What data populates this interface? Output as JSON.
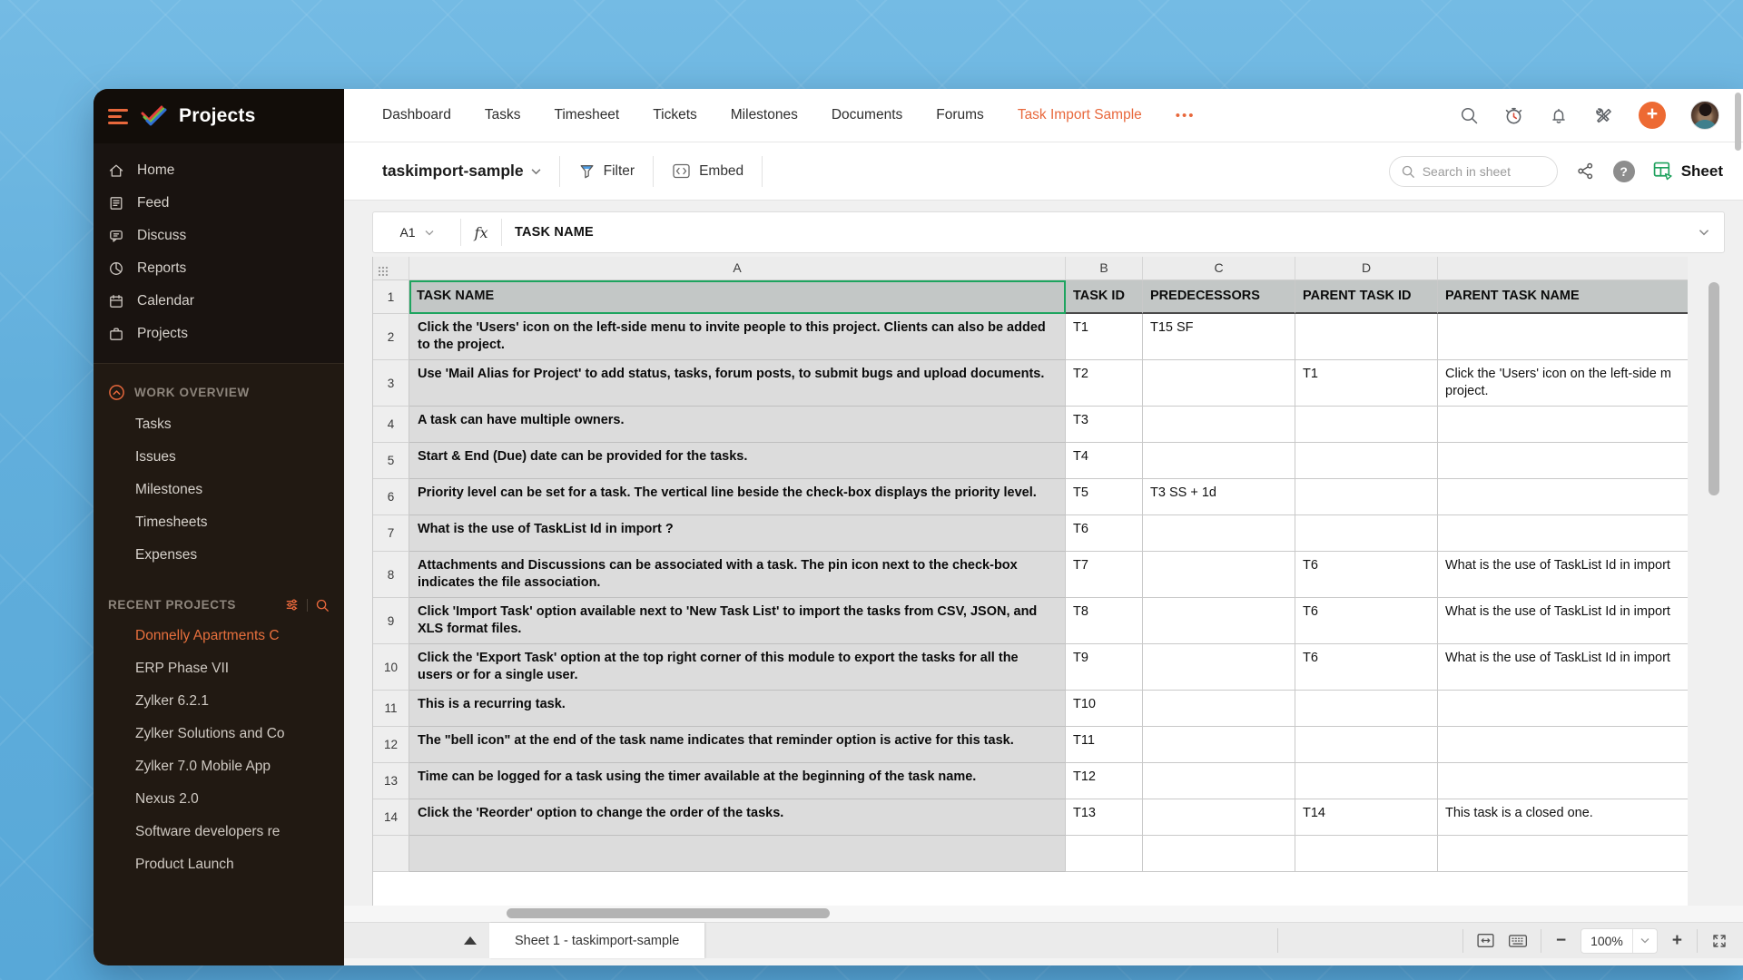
{
  "sidebar": {
    "brand": "Projects",
    "menu": [
      {
        "icon": "home-icon",
        "label": "Home"
      },
      {
        "icon": "feed-icon",
        "label": "Feed"
      },
      {
        "icon": "discuss-icon",
        "label": "Discuss"
      },
      {
        "icon": "reports-icon",
        "label": "Reports"
      },
      {
        "icon": "calendar-icon",
        "label": "Calendar"
      },
      {
        "icon": "projects-icon",
        "label": "Projects"
      }
    ],
    "work_overview": {
      "label": "WORK OVERVIEW",
      "items": [
        "Tasks",
        "Issues",
        "Milestones",
        "Timesheets",
        "Expenses"
      ]
    },
    "recent_projects": {
      "label": "RECENT PROJECTS",
      "items": [
        {
          "label": "Donnelly Apartments C",
          "active": true
        },
        {
          "label": "ERP Phase VII",
          "active": false
        },
        {
          "label": "Zylker 6.2.1",
          "active": false
        },
        {
          "label": "Zylker Solutions and Co",
          "active": false
        },
        {
          "label": "Zylker 7.0 Mobile App",
          "active": false
        },
        {
          "label": "Nexus 2.0",
          "active": false
        },
        {
          "label": "Software developers re",
          "active": false
        },
        {
          "label": "Product Launch",
          "active": false
        }
      ]
    }
  },
  "topnav": {
    "items": [
      "Dashboard",
      "Tasks",
      "Timesheet",
      "Tickets",
      "Milestones",
      "Documents",
      "Forums"
    ],
    "active": "Task Import Sample",
    "more": "•••"
  },
  "toolbar": {
    "title": "taskimport-sample",
    "filter": "Filter",
    "embed": "Embed",
    "search_placeholder": "Search in sheet",
    "help": "?",
    "sheet": "Sheet"
  },
  "formula_bar": {
    "cell_ref": "A1",
    "fx": "fx",
    "value": "TASK NAME"
  },
  "grid": {
    "column_letters": [
      "A",
      "B",
      "C",
      "D",
      ""
    ],
    "headers": [
      "TASK NAME",
      "TASK ID",
      "PREDECESSORS",
      "PARENT TASK ID",
      "PARENT TASK NAME"
    ],
    "rows": [
      {
        "row": 2,
        "task_name": "Click the 'Users' icon on the left-side menu to invite people to this project. Clients can also be added to the project.",
        "task_id": "T1",
        "predecessors": "T15 SF",
        "parent_task_id": "",
        "parent_task_name": []
      },
      {
        "row": 3,
        "task_name": "Use 'Mail Alias for Project' to add status, tasks, forum posts, to submit bugs and upload documents.",
        "task_id": "T2",
        "predecessors": "",
        "parent_task_id": "T1",
        "parent_task_name": [
          "Click the 'Users' icon on the left-side m",
          "project."
        ]
      },
      {
        "row": 4,
        "task_name": "A task can have multiple owners.",
        "task_id": "T3",
        "predecessors": "",
        "parent_task_id": "",
        "parent_task_name": []
      },
      {
        "row": 5,
        "task_name": "Start & End (Due) date can be provided for the tasks.",
        "task_id": "T4",
        "predecessors": "",
        "parent_task_id": "",
        "parent_task_name": []
      },
      {
        "row": 6,
        "task_name": "Priority level can be set for a task. The vertical line beside the check-box displays the priority level.",
        "task_id": "T5",
        "predecessors": "T3 SS + 1d",
        "parent_task_id": "",
        "parent_task_name": []
      },
      {
        "row": 7,
        "task_name": "What is the use of TaskList Id in import ?",
        "task_id": "T6",
        "predecessors": "",
        "parent_task_id": "",
        "parent_task_name": []
      },
      {
        "row": 8,
        "task_name": "Attachments and Discussions can be associated with a task. The pin icon next to the check-box indicates the file association.",
        "task_id": "T7",
        "predecessors": "",
        "parent_task_id": "T6",
        "parent_task_name": [
          "What is the use of TaskList Id in import"
        ]
      },
      {
        "row": 9,
        "task_name": "Click 'Import Task' option available next to 'New Task List' to import the tasks from CSV, JSON, and XLS format files.",
        "task_id": "T8",
        "predecessors": "",
        "parent_task_id": "T6",
        "parent_task_name": [
          "What is the use of TaskList Id in import"
        ]
      },
      {
        "row": 10,
        "task_name": "Click the 'Export Task' option at the top right corner of this module to export the tasks for  all the users or for a single user.",
        "task_id": "T9",
        "predecessors": "",
        "parent_task_id": "T6",
        "parent_task_name": [
          "What is the use of TaskList Id in import"
        ]
      },
      {
        "row": 11,
        "task_name": "This is a recurring task.",
        "task_id": "T10",
        "predecessors": "",
        "parent_task_id": "",
        "parent_task_name": []
      },
      {
        "row": 12,
        "task_name": "The \"bell icon\" at the end of the task name indicates that reminder option is active for this task.",
        "task_id": "T11",
        "predecessors": "",
        "parent_task_id": "",
        "parent_task_name": []
      },
      {
        "row": 13,
        "task_name": "Time can be logged for a task using the timer available at the beginning of the task name.",
        "task_id": "T12",
        "predecessors": "",
        "parent_task_id": "",
        "parent_task_name": []
      },
      {
        "row": 14,
        "task_name": "Click the 'Reorder' option to change the order of the tasks.",
        "task_id": "T13",
        "predecessors": "",
        "parent_task_id": "T14",
        "parent_task_name": [
          "This task is a closed one."
        ]
      }
    ]
  },
  "bottom": {
    "sheet_tab": "Sheet 1 - taskimport-sample",
    "zoom": "100%"
  },
  "colors": {
    "accent_orange": "#e8683c",
    "selection_green": "#1ea45f",
    "sheet_green": "#1fa15d",
    "filter_blue": "#4d9fe8"
  }
}
